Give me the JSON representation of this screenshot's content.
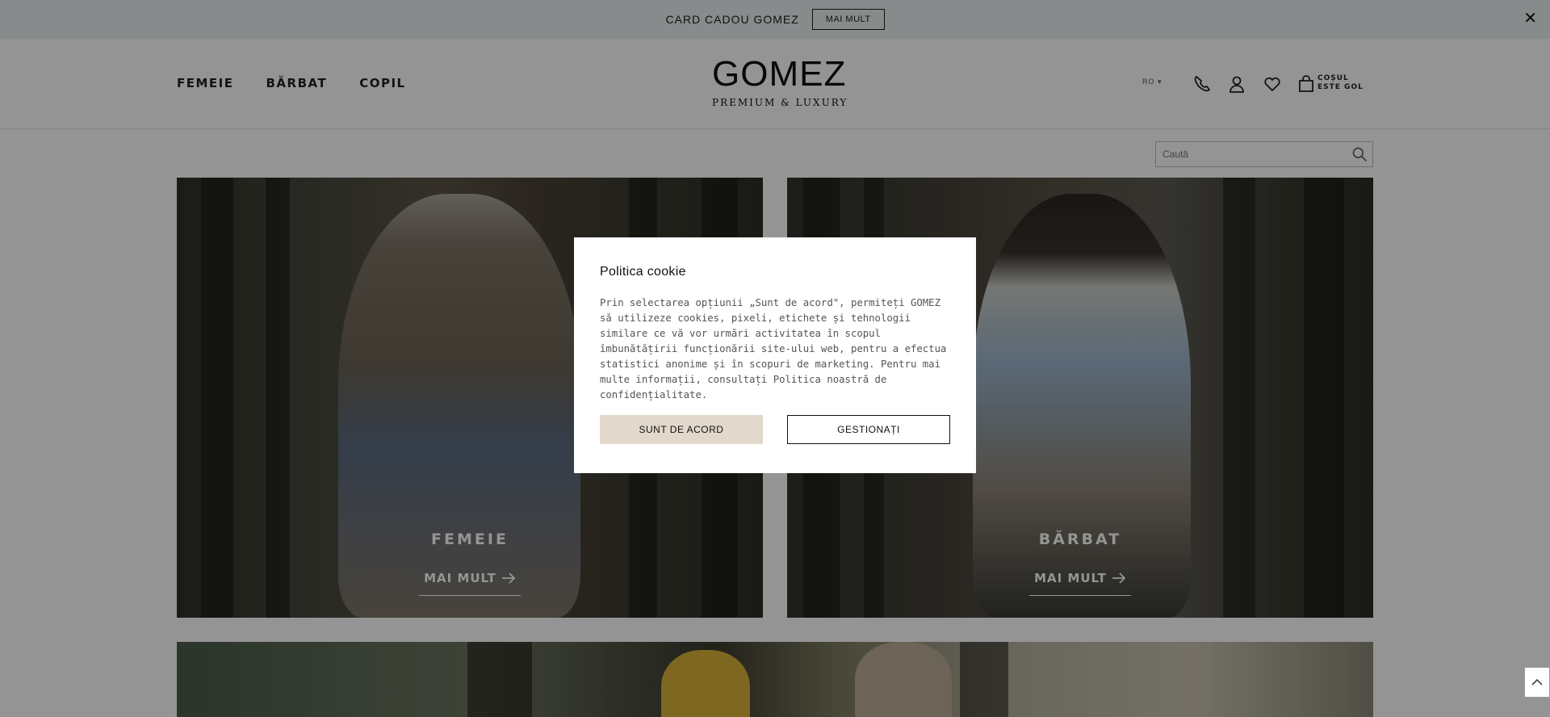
{
  "topbar": {
    "text": "CARD CADOU GOMEZ",
    "button": "MAI MULT",
    "close_symbol": "✕"
  },
  "header": {
    "nav": [
      {
        "label": "FEMEIE"
      },
      {
        "label": "BĂRBAT"
      },
      {
        "label": "COPIL"
      }
    ],
    "logo": {
      "name": "GOMEZ",
      "tagline": "PREMIUM & LUXURY"
    },
    "language": "RO ▾",
    "icons": [
      "phone-icon",
      "user-icon",
      "heart-icon",
      "bag-icon"
    ],
    "cart": {
      "line1": "COȘUL",
      "line2": "ESTE GOL"
    }
  },
  "search": {
    "placeholder": "Caută"
  },
  "banners": [
    {
      "title": "FEMEIE",
      "link": "MAI MULT"
    },
    {
      "title": "BĂRBAT",
      "link": "MAI MULT"
    }
  ],
  "cookie": {
    "title": "Politica cookie",
    "body": "Prin selectarea opțiunii „Sunt de acord\", permiteți GOMEZ să utilizeze cookies, pixeli, etichete și tehnologii similare ce vă vor urmări activitatea în scopul îmbunătățirii funcționării site-ului web, pentru a efectua statistici anonime și în scopuri de marketing. Pentru mai multe informații, consultați Politica noastră de confidențialitate.",
    "accept": "SUNT DE ACORD",
    "manage": "GESTIONAȚI"
  },
  "colors": {
    "overlay": "#000000",
    "accept_button": "#e2d8cb",
    "topbar": "#e9eff1"
  }
}
